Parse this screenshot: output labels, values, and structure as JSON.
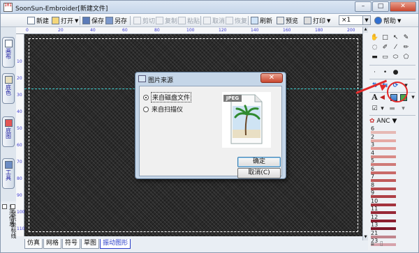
{
  "window": {
    "app_icon_text": "101",
    "title": "SoonSun-Embroider[新建文件]",
    "btn_minimize": "–",
    "btn_maximize": "□",
    "btn_close": "✕"
  },
  "toolbar": {
    "new": "新建",
    "open": "打开",
    "save": "保存",
    "save_as": "另存",
    "cut": "剪切",
    "copy": "复制",
    "paste": "粘贴",
    "undo": "取消",
    "redo": "恢复",
    "refresh": "刷新",
    "preview": "预览",
    "print": "打印",
    "zoom": "×1",
    "help": "帮助"
  },
  "left_tabs": [
    "画布",
    "底色",
    "底图",
    "工具"
  ],
  "left_options": {
    "show_info": "显示信息",
    "show_ruler": "显示坐标线"
  },
  "ruler": {
    "top": [
      "0",
      "20",
      "40",
      "60",
      "80",
      "100",
      "120",
      "140",
      "160",
      "180",
      "200"
    ],
    "left": [
      "10",
      "20",
      "30",
      "40",
      "50",
      "60",
      "70",
      "80",
      "90",
      "100",
      "110"
    ]
  },
  "bottom_tabs": [
    "仿真",
    "网格",
    "符号",
    "草图",
    "振动图形"
  ],
  "right_panel": {
    "tool_text": "A",
    "color_set": "ANC",
    "thread_numbers": [
      "6",
      "2",
      "3",
      "4",
      "5",
      "6",
      "7",
      "8",
      "9",
      "10",
      "11",
      "12",
      "13",
      "21",
      "23"
    ],
    "thread_colors": [
      "#e6b9b4",
      "#e5a9a4",
      "#e29a95",
      "#d98a86",
      "#cf7a77",
      "#c96a68",
      "#c05a5a",
      "#b84d50",
      "#ae4046",
      "#a3333d",
      "#972836",
      "#8b1e2f",
      "#7e1628",
      "#c0848c",
      "#d6a3ab"
    ]
  },
  "dialog": {
    "title": "图片来源",
    "close": "✕",
    "option_file": "来自磁盘文件",
    "option_scanner": "来自扫描仪",
    "jpeg_label": "JPEG",
    "ok": "确定",
    "cancel": "取消(C)"
  }
}
